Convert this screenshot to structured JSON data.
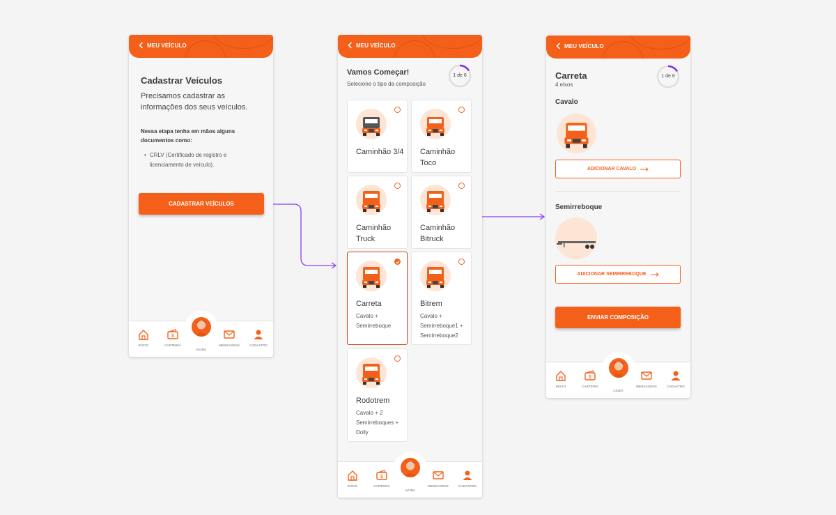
{
  "colors": {
    "accent": "#f4601a",
    "connector": "#8a3ff0",
    "bg": "#f4f4f4"
  },
  "header": {
    "back_label": "MEU VEÍCULO"
  },
  "nav": {
    "items": [
      {
        "icon": "home-icon",
        "label": "INÍCIO"
      },
      {
        "icon": "wallet-icon",
        "label": "CARTEIRA"
      },
      {
        "icon": "avatar",
        "label": "AJUDA"
      },
      {
        "icon": "mail-icon",
        "label": "MENSAGENS"
      },
      {
        "icon": "user-icon",
        "label": "CADASTRO"
      }
    ]
  },
  "screen1": {
    "title": "Cadastrar Veículos",
    "subtitle": "Precisamos cadastrar as informações dos seus veículos.",
    "hint": "Nessa etapa tenha em mãos alguns documentos como:",
    "list_bullet": "•",
    "list_item": "CRLV (Certificado de registro e licenciamento de veículo).",
    "button": "CADASTRAR VEÍCULOS"
  },
  "screen2": {
    "title": "Vamos Começar!",
    "subtitle": "Selecione o tipo da composição",
    "progress_label": "1 de 6",
    "progress_fraction": 0.1667,
    "cards": [
      {
        "name": "Caminhão 3/4",
        "desc": "",
        "selected": false,
        "icon": "truck-34-icon"
      },
      {
        "name": "Caminhão Toco",
        "desc": "",
        "selected": false,
        "icon": "truck-toco-icon"
      },
      {
        "name": "Caminhão Truck",
        "desc": "",
        "selected": false,
        "icon": "truck-truck-icon"
      },
      {
        "name": "Caminhão Bitruck",
        "desc": "",
        "selected": false,
        "icon": "truck-bitruck-icon"
      },
      {
        "name": "Carreta",
        "desc": "Cavalo + Semirreboque",
        "selected": true,
        "icon": "carreta-icon"
      },
      {
        "name": "Bitrem",
        "desc": "Cavalo + Semirreboque1 + Semirreboque2",
        "selected": false,
        "icon": "bitrem-icon"
      },
      {
        "name": "Rodotrem",
        "desc": "Cavalo + 2 Semirreboques + Dolly",
        "selected": false,
        "icon": "rodotrem-icon"
      }
    ]
  },
  "screen3": {
    "title": "Carreta",
    "subtitle": "4 eixos",
    "progress_label": "1 de 6",
    "progress_fraction": 0.1667,
    "section1": "Cavalo",
    "button1": "ADICIONAR CAVALO",
    "section2": "Semirreboque",
    "button2": "ADICIONAR SEMIRREBOQUE",
    "submit": "ENVIAR COMPOSIÇÃO"
  }
}
